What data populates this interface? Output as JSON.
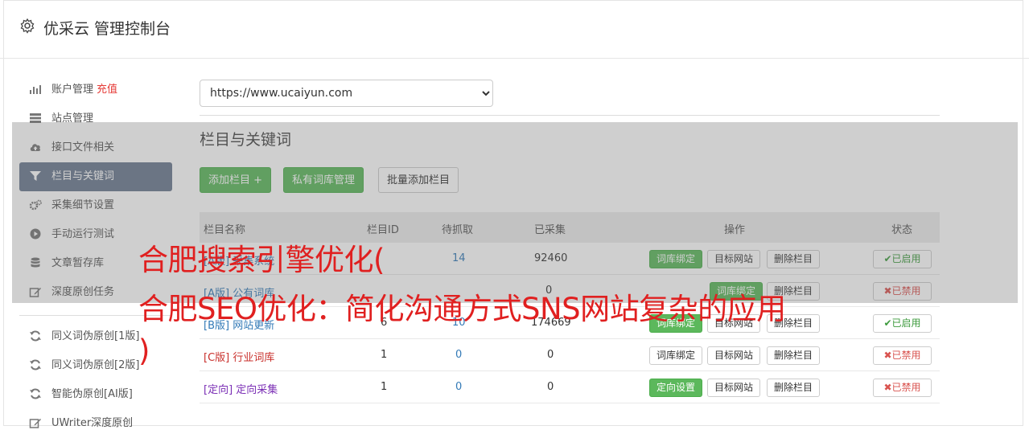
{
  "header": {
    "title": "优采云 管理控制台"
  },
  "sidebar": {
    "items": [
      {
        "label": "账户管理",
        "extra": "充值",
        "icon": "bar-chart-icon"
      },
      {
        "label": "站点管理",
        "icon": "server-icon"
      },
      {
        "label": "接口文件相关",
        "icon": "cloud-upload-icon"
      },
      {
        "label": "栏目与关键词",
        "icon": "filter-icon",
        "active": true
      },
      {
        "label": "采集细节设置",
        "icon": "cogs-icon"
      },
      {
        "label": "手动运行测试",
        "icon": "play-circle-icon"
      },
      {
        "label": "文章暂存库",
        "icon": "database-icon"
      },
      {
        "label": "深度原创任务",
        "icon": "edit-icon"
      }
    ],
    "items2": [
      {
        "label": "同义词伪原创[1版]",
        "icon": "refresh-icon"
      },
      {
        "label": "同义词伪原创[2版]",
        "icon": "refresh-icon"
      },
      {
        "label": "智能伪原创[AI版]",
        "icon": "refresh-icon"
      },
      {
        "label": "UWriter深度原创",
        "icon": "edit-icon"
      }
    ]
  },
  "main": {
    "site_select": "https://www.ucaiyun.com",
    "section_title": "栏目与关键词",
    "buttons": {
      "add": "添加栏目 +",
      "private_lib": "私有词库管理",
      "batch_add": "批量添加栏目"
    },
    "table": {
      "headers": [
        "栏目名称",
        "栏目ID",
        "待抓取",
        "已采集",
        "操作",
        "状态"
      ],
      "rows": [
        {
          "tag": "[A版]",
          "name": "采集系统",
          "id": "",
          "pending": "14",
          "collected": "92460",
          "bind": "词库绑定",
          "bind_green": true,
          "target": "目标网站",
          "delete": "删除栏目",
          "status": "已启用",
          "status_on": true
        },
        {
          "tag": "[A版]",
          "name": "公有词库",
          "id": "",
          "pending": "",
          "collected": "0",
          "bind": "词库绑定",
          "bind_green": true,
          "target": "目标网站",
          "delete": "删除栏目",
          "status": "已禁用",
          "status_on": false
        },
        {
          "tag": "[B版]",
          "name": "网站更新",
          "id": "6",
          "pending": "10",
          "collected": "174669",
          "bind": "词库绑定",
          "bind_green": true,
          "target": "目标网站",
          "delete": "删除栏目",
          "status": "已启用",
          "status_on": true
        },
        {
          "tag": "[C版]",
          "name": "行业词库",
          "id": "1",
          "pending": "0",
          "collected": "0",
          "bind": "词库绑定",
          "bind_green": false,
          "target": "目标网站",
          "delete": "删除栏目",
          "status": "已禁用",
          "status_on": false
        },
        {
          "tag": "[定向]",
          "name": "定向采集",
          "id": "1",
          "pending": "0",
          "collected": "0",
          "bind": "定向设置",
          "bind_green": true,
          "target": "目标网站",
          "delete": "删除栏目",
          "status": "已禁用",
          "status_on": false
        }
      ]
    }
  },
  "promo": {
    "line1": "合肥搜索引擎优化(",
    "line2": "合肥SEO优化：简化沟通方式SNS网站复杂的应用",
    "line3": ")"
  },
  "colors": {
    "accent_green": "#5cb85c",
    "active_nav": "#6b7a8f",
    "promo_red": "#e02020"
  }
}
